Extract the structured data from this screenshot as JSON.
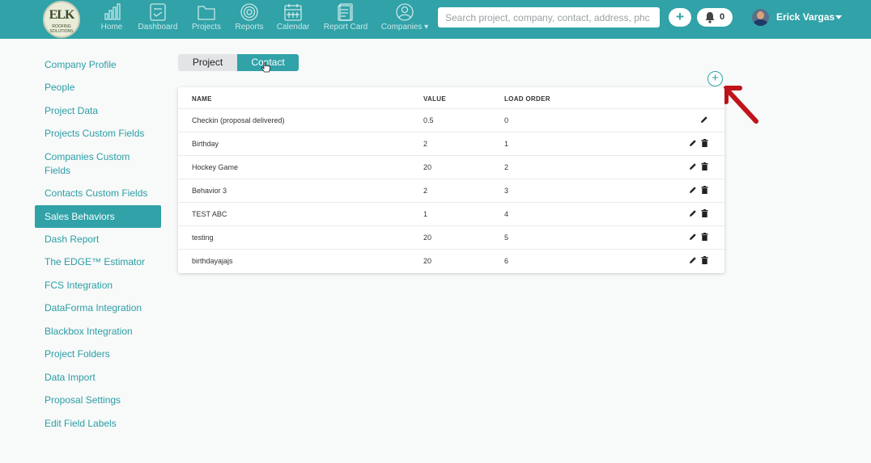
{
  "brand": {
    "logo_word": "ELK",
    "logo_sub": "ROOFING SOLUTIONS"
  },
  "nav": [
    {
      "label": "Home",
      "icon": "bar-chart-icon"
    },
    {
      "label": "Dashboard",
      "icon": "dashboard-icon"
    },
    {
      "label": "Projects",
      "icon": "folder-icon"
    },
    {
      "label": "Reports",
      "icon": "target-icon"
    },
    {
      "label": "Calendar",
      "icon": "calendar-icon"
    },
    {
      "label": "Report Card",
      "icon": "report-card-icon"
    },
    {
      "label": "Companies ▾",
      "icon": "user-circle-icon"
    }
  ],
  "search": {
    "placeholder": "Search project, company, contact, address, phc",
    "value": ""
  },
  "header": {
    "plus_label": "+",
    "notifications_count": "0",
    "user_name": "Erick Vargas"
  },
  "sidebar": {
    "items": [
      {
        "label": "Company Profile"
      },
      {
        "label": "People"
      },
      {
        "label": "Project Data"
      },
      {
        "label": "Projects Custom Fields"
      },
      {
        "label": "Companies Custom Fields"
      },
      {
        "label": "Contacts Custom Fields"
      },
      {
        "label": "Sales Behaviors",
        "active": true
      },
      {
        "label": "Dash Report"
      },
      {
        "label": "The EDGE™ Estimator"
      },
      {
        "label": "FCS Integration"
      },
      {
        "label": "DataForma Integration"
      },
      {
        "label": "Blackbox Integration"
      },
      {
        "label": "Project Folders"
      },
      {
        "label": "Data Import"
      },
      {
        "label": "Proposal Settings"
      },
      {
        "label": "Edit Field Labels"
      }
    ]
  },
  "tabs": {
    "project": "Project",
    "contact": "Contact",
    "active": "Contact"
  },
  "add_button": {
    "label": "+"
  },
  "table": {
    "headers": {
      "name": "NAME",
      "value": "VALUE",
      "load_order": "LOAD ORDER"
    },
    "rows": [
      {
        "name": "Checkin (proposal delivered)",
        "value": "0.5",
        "load_order": "0",
        "deletable": false
      },
      {
        "name": "Birthday",
        "value": "2",
        "load_order": "1",
        "deletable": true
      },
      {
        "name": "Hockey Game",
        "value": "20",
        "load_order": "2",
        "deletable": true
      },
      {
        "name": "Behavior 3",
        "value": "2",
        "load_order": "3",
        "deletable": true
      },
      {
        "name": "TEST ABC",
        "value": "1",
        "load_order": "4",
        "deletable": true
      },
      {
        "name": "testing",
        "value": "20",
        "load_order": "5",
        "deletable": true
      },
      {
        "name": "birthdayajajs",
        "value": "20",
        "load_order": "6",
        "deletable": true
      }
    ]
  },
  "colors": {
    "accent": "#30a2a8",
    "annotation": "#c0141b",
    "background": "#f8f9f9"
  }
}
